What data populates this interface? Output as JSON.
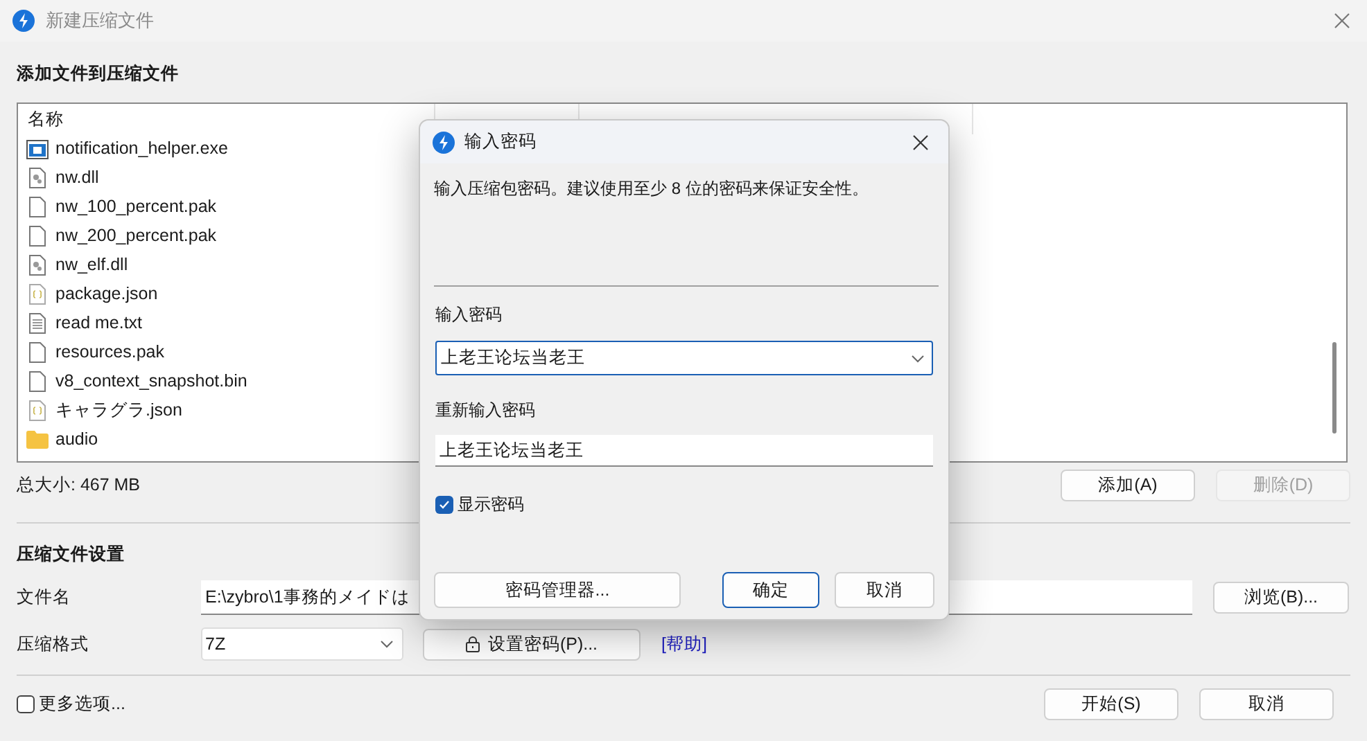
{
  "window": {
    "title": "新建压缩文件"
  },
  "add_section": {
    "heading": "添加文件到压缩文件"
  },
  "file_list": {
    "columns": [
      "名称"
    ],
    "rows": [
      {
        "name": "notification_helper.exe",
        "kind": "exe"
      },
      {
        "name": "nw.dll",
        "kind": "dll"
      },
      {
        "name": "nw_100_percent.pak",
        "kind": "file"
      },
      {
        "name": "nw_200_percent.pak",
        "kind": "file"
      },
      {
        "name": "nw_elf.dll",
        "kind": "dll"
      },
      {
        "name": "package.json",
        "kind": "json"
      },
      {
        "name": "read me.txt",
        "kind": "text"
      },
      {
        "name": "resources.pak",
        "kind": "file"
      },
      {
        "name": "v8_context_snapshot.bin",
        "kind": "file"
      },
      {
        "name": "キャラグラ.json",
        "kind": "json"
      },
      {
        "name": "audio",
        "kind": "folder"
      }
    ]
  },
  "total_size": "总大小: 467 MB",
  "list_buttons": [
    {
      "label": "添加(A)",
      "disabled": false
    },
    {
      "label": "删除(D)",
      "disabled": true
    }
  ],
  "settings": {
    "heading": "压缩文件设置",
    "filename_label": "文件名",
    "filename_value": "E:\\zybro\\1事務的メイドは",
    "browse_button": "浏览(B)...",
    "format_label": "压缩格式",
    "format_value": "7Z",
    "password_button": "设置密码(P)...",
    "help_link": "[帮助]"
  },
  "more_options": {
    "label": "更多选项...",
    "checked": false
  },
  "bottom_buttons": [
    "开始(S)",
    "取消"
  ],
  "password_dialog": {
    "title": "输入密码",
    "description": "输入压缩包密码。建议使用至少 8 位的密码来保证安全性。",
    "password_label": "输入密码",
    "password_value": "上老王论坛当老王",
    "confirm_label": "重新输入密码",
    "confirm_value": "上老王论坛当老王",
    "show_password": {
      "label": "显示密码",
      "checked": true
    },
    "buttons": [
      {
        "label": "密码管理器...",
        "kind": "wide"
      },
      {
        "label": "确定",
        "kind": "default"
      },
      {
        "label": "取消",
        "kind": "normal"
      }
    ]
  }
}
